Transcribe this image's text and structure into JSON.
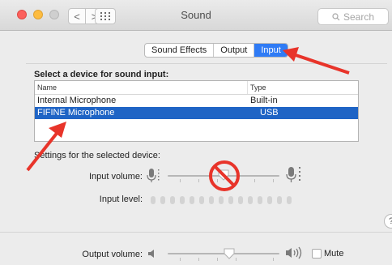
{
  "titlebar": {
    "title": "Sound",
    "search_placeholder": "Search",
    "back_glyph": "<",
    "forward_glyph": ">",
    "grid_icon": "grid-icon"
  },
  "tabs": [
    {
      "label": "Sound Effects",
      "active": false
    },
    {
      "label": "Output",
      "active": false
    },
    {
      "label": "Input",
      "active": true
    }
  ],
  "device_section": {
    "title": "Select a device for sound input:",
    "columns": [
      "Name",
      "Type"
    ],
    "rows": [
      {
        "name": "Internal Microphone",
        "type": "Built-in",
        "selected": false
      },
      {
        "name": "FIFINE Microphone",
        "type": "USB",
        "selected": true
      }
    ]
  },
  "settings": {
    "label": "Settings for the selected device:",
    "input_volume_label": "Input volume:",
    "input_level_label": "Input level:",
    "input_volume_level": 0.5,
    "input_level_value": 0
  },
  "output": {
    "label": "Output volume:",
    "volume_level": 0.55,
    "mute_label": "Mute",
    "mute_checked": false
  },
  "help_glyph": "?",
  "colors": {
    "accent": "#2f7bf5",
    "selection": "#1f64c5",
    "annotation": "#e8342a"
  }
}
